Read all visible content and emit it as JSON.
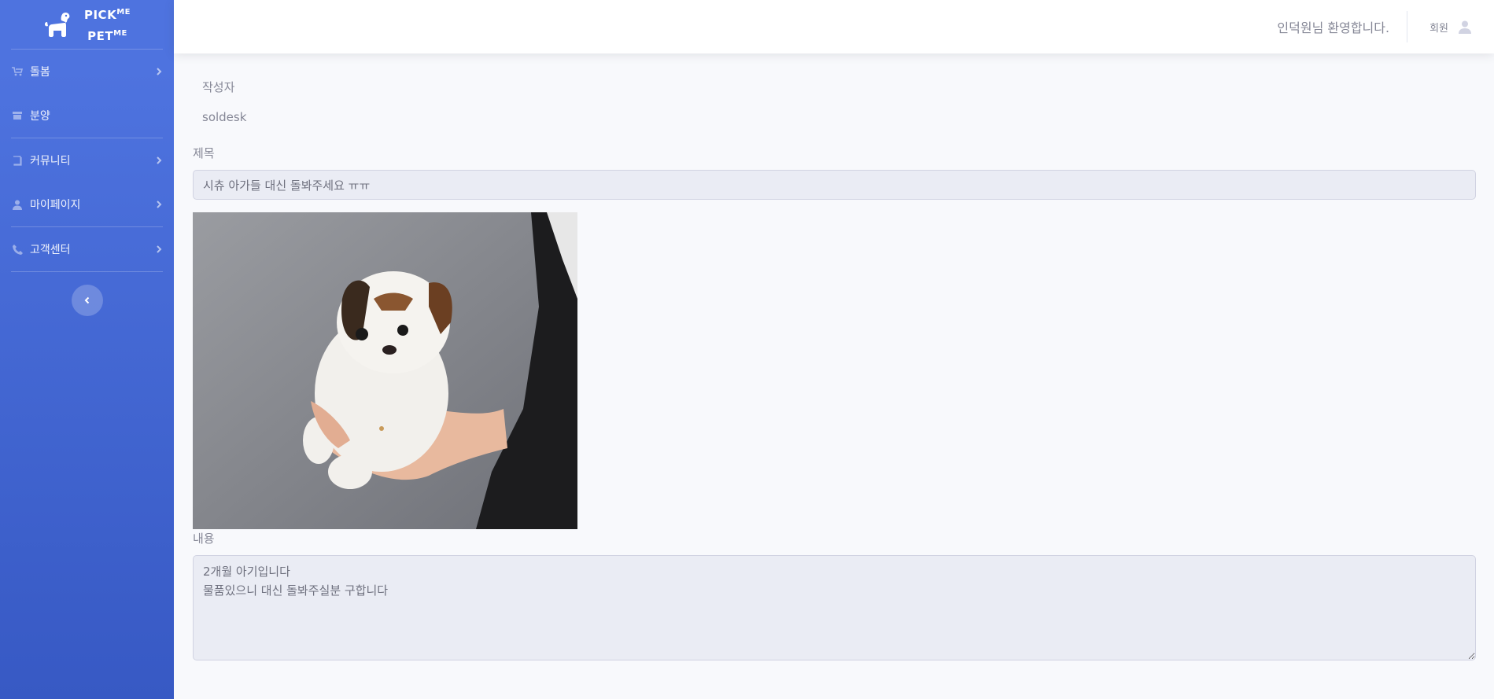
{
  "brand": {
    "line1": "PICK",
    "line1_sup": "ME",
    "line2": "PET",
    "line2_sup": "ME",
    "icon": "dog-icon"
  },
  "sidebar": {
    "items": [
      {
        "label": "돌봄",
        "icon": "dog-cart-icon",
        "has_submenu": true
      },
      {
        "label": "분양",
        "icon": "shop-icon",
        "has_submenu": false
      },
      {
        "label": "커뮤니티",
        "icon": "book-icon",
        "has_submenu": true
      },
      {
        "label": "마이페이지",
        "icon": "user-icon",
        "has_submenu": true
      },
      {
        "label": "고객센터",
        "icon": "phone-icon",
        "has_submenu": true
      }
    ],
    "toggle_icon": "chevron-left-icon"
  },
  "topbar": {
    "welcome": "인덕원님 환영합니다.",
    "user_label": "회원",
    "user_icon": "user-icon"
  },
  "post": {
    "author_label": "작성자",
    "author": "soldesk",
    "title_label": "제목",
    "title": "시츄 아가들 대신 돌봐주세요 ㅠㅠ",
    "content_label": "내용",
    "content": "2개월 아기입니다\n물품있으니 대신 돌봐주실분 구합니다"
  },
  "colors": {
    "sidebar_top": "#4e73df",
    "sidebar_bottom": "#3759c4",
    "page_bg": "#f8f9fc",
    "input_bg": "#eaecf4",
    "text": "#858796"
  }
}
